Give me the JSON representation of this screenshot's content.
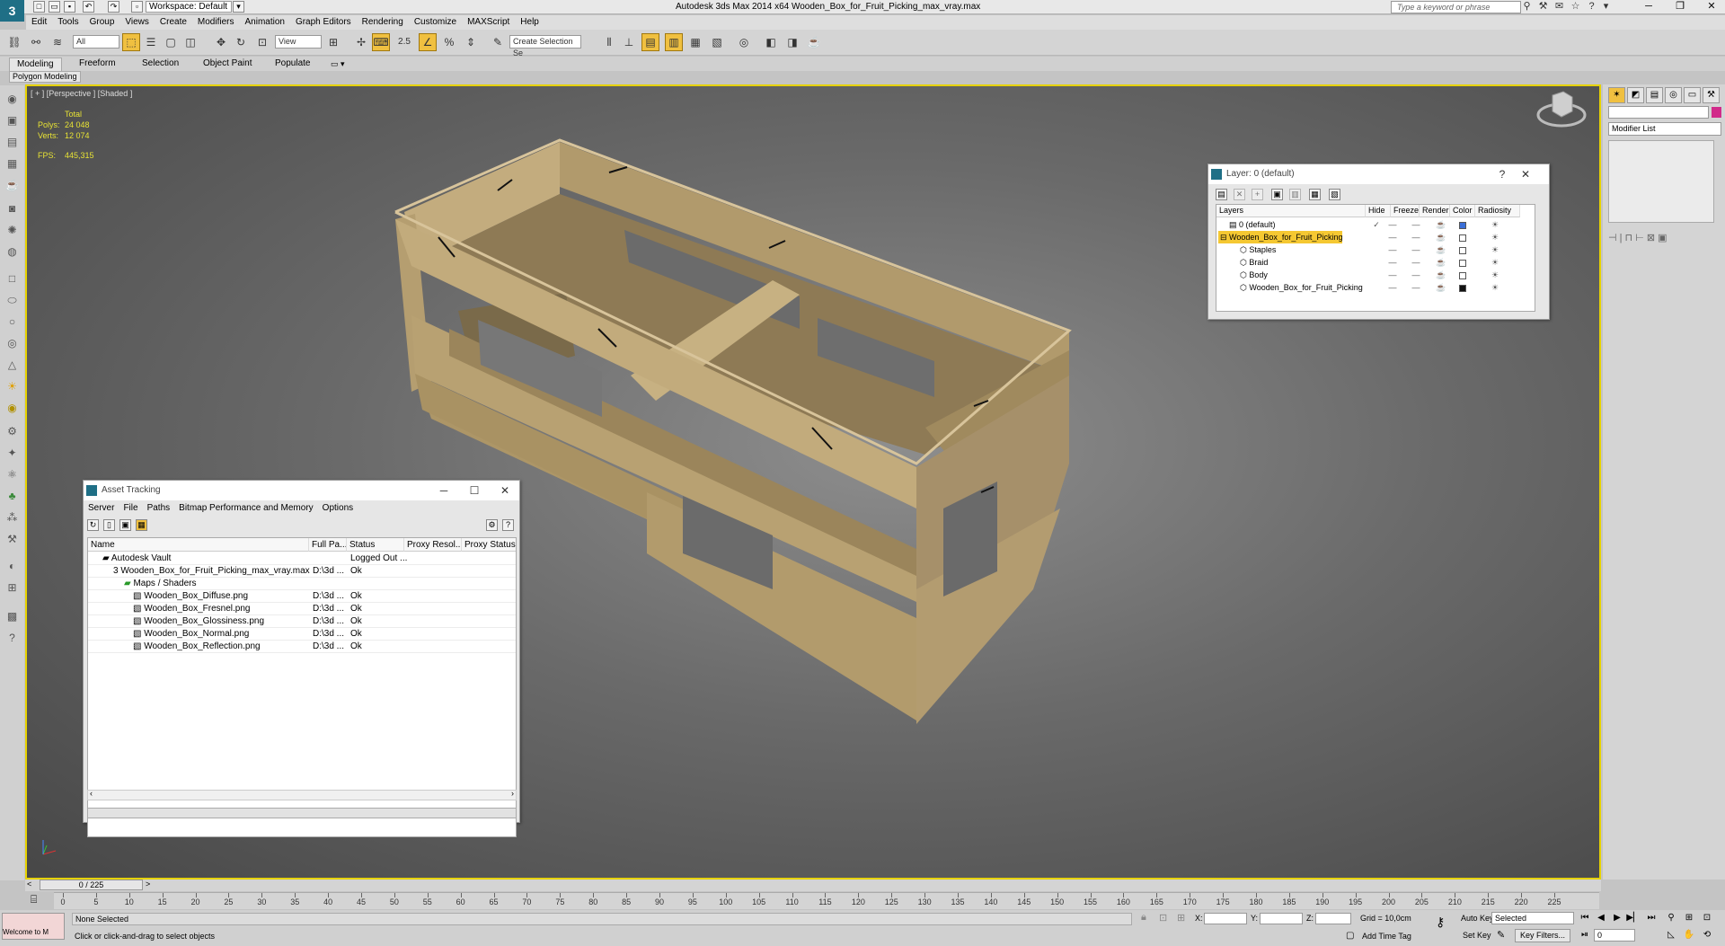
{
  "app": {
    "title": "Autodesk 3ds Max  2014 x64     Wooden_Box_for_Fruit_Picking_max_vray.max",
    "workspace": "Workspace: Default",
    "search_placeholder": "Type a keyword or phrase"
  },
  "menu": [
    "Edit",
    "Tools",
    "Group",
    "Views",
    "Create",
    "Modifiers",
    "Animation",
    "Graph Editors",
    "Rendering",
    "Customize",
    "MAXScript",
    "Help"
  ],
  "toolbar": {
    "filter": "All",
    "ref_coord": "View",
    "snap_value": "2.5",
    "named_selection": "Create Selection Se"
  },
  "ribbon": {
    "tabs": [
      "Modeling",
      "Freeform",
      "Selection",
      "Object Paint",
      "Populate"
    ],
    "sub_label": "Polygon Modeling"
  },
  "viewport": {
    "label": "[ + ] [Perspective ] [Shaded ]",
    "stats_header": "Total",
    "polys_label": "Polys:",
    "polys": "24 048",
    "verts_label": "Verts:",
    "verts": "12 074",
    "fps_label": "FPS:",
    "fps": "445,315"
  },
  "command_panel": {
    "modifier_list": "Modifier List"
  },
  "layer_dialog": {
    "title": "Layer: 0 (default)",
    "headers": [
      "Layers",
      "Hide",
      "Freeze",
      "Render",
      "Color",
      "Radiosity"
    ],
    "rows": [
      {
        "name": "0 (default)",
        "color": "#3a6fd8",
        "current": true
      },
      {
        "name": "Wooden_Box_for_Fruit_Picking",
        "color": "#ffffff",
        "selected": true
      },
      {
        "name": "Staples",
        "color": "#ffffff"
      },
      {
        "name": "Braid",
        "color": "#ffffff"
      },
      {
        "name": "Body",
        "color": "#ffffff"
      },
      {
        "name": "Wooden_Box_for_Fruit_Picking",
        "color": "#111111"
      }
    ]
  },
  "asset_dialog": {
    "title": "Asset Tracking",
    "menu": [
      "Server",
      "File",
      "Paths",
      "Bitmap Performance and Memory",
      "Options"
    ],
    "headers": [
      "Name",
      "Full Pa...",
      "Status",
      "Proxy Resol...",
      "Proxy Status"
    ],
    "rows": [
      {
        "name": "Autodesk Vault",
        "path": "",
        "status": "Logged Out ..."
      },
      {
        "name": "Wooden_Box_for_Fruit_Picking_max_vray.max",
        "path": "D:\\3d ...",
        "status": "Ok"
      },
      {
        "name": "Maps / Shaders",
        "path": "",
        "status": ""
      },
      {
        "name": "Wooden_Box_Diffuse.png",
        "path": "D:\\3d ...",
        "status": "Ok"
      },
      {
        "name": "Wooden_Box_Fresnel.png",
        "path": "D:\\3d ...",
        "status": "Ok"
      },
      {
        "name": "Wooden_Box_Glossiness.png",
        "path": "D:\\3d ...",
        "status": "Ok"
      },
      {
        "name": "Wooden_Box_Normal.png",
        "path": "D:\\3d ...",
        "status": "Ok"
      },
      {
        "name": "Wooden_Box_Reflection.png",
        "path": "D:\\3d ...",
        "status": "Ok"
      }
    ]
  },
  "timeline": {
    "frame_counter": "0 / 225",
    "ticks": [
      "0",
      "5",
      "10",
      "15",
      "20",
      "25",
      "30",
      "35",
      "40",
      "45",
      "50",
      "55",
      "60",
      "65",
      "70",
      "75",
      "80",
      "85",
      "90",
      "95",
      "100",
      "105",
      "110",
      "115",
      "120",
      "125",
      "130",
      "135",
      "140",
      "145",
      "150",
      "155",
      "160",
      "165",
      "170",
      "175",
      "180",
      "185",
      "190",
      "195",
      "200",
      "205",
      "210",
      "215",
      "220",
      "225"
    ]
  },
  "status": {
    "maxscript": "Welcome to M",
    "selection": "None Selected",
    "prompt": "Click or click-and-drag to select objects",
    "x_label": "X:",
    "y_label": "Y:",
    "z_label": "Z:",
    "grid": "Grid = 10,0cm",
    "add_time_tag": "Add Time Tag",
    "auto_key": "Auto Key",
    "set_key": "Set Key",
    "key_mode": "Selected",
    "key_filters": "Key Filters...",
    "current_frame": "0"
  }
}
